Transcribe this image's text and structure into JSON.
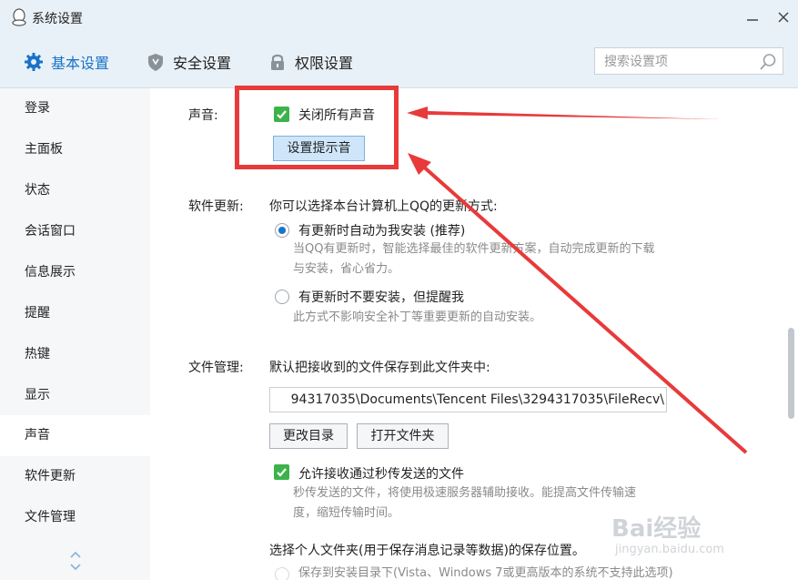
{
  "window": {
    "title": "系统设置",
    "minimize_icon": "minimize-icon",
    "close_icon": "close-icon"
  },
  "toolbar": {
    "tabs": [
      {
        "label": "基本设置",
        "icon": "gear-icon",
        "active": true
      },
      {
        "label": "安全设置",
        "icon": "shield-icon",
        "active": false
      },
      {
        "label": "权限设置",
        "icon": "lock-icon",
        "active": false
      }
    ],
    "search_placeholder": "搜索设置项"
  },
  "sidebar": {
    "items": [
      {
        "label": "登录"
      },
      {
        "label": "主面板"
      },
      {
        "label": "状态"
      },
      {
        "label": "会话窗口"
      },
      {
        "label": "信息展示"
      },
      {
        "label": "提醒"
      },
      {
        "label": "热键"
      },
      {
        "label": "显示"
      },
      {
        "label": "声音",
        "active": true
      },
      {
        "label": "软件更新"
      },
      {
        "label": "文件管理"
      }
    ]
  },
  "sound": {
    "label": "声音:",
    "mute_all": "关闭所有声音",
    "mute_all_checked": true,
    "set_tone_button": "设置提示音"
  },
  "update": {
    "label": "软件更新:",
    "intro": "你可以选择本台计算机上QQ的更新方式:",
    "option_auto": "有更新时自动为我安装 (推荐)",
    "option_auto_desc_1": "当QQ有更新时，智能选择最佳的软件更新方案，自动完成更新的下载",
    "option_auto_desc_2": "与安装，省心省力。",
    "option_notify": "有更新时不要安装，但提醒我",
    "option_notify_desc": "此方式不影响安全补丁等重要更新的自动安装。",
    "selected": "option_auto"
  },
  "files": {
    "label": "文件管理:",
    "intro": "默认把接收到的文件保存到此文件夹中:",
    "path": "94317035\\Documents\\Tencent Files\\3294317035\\FileRecv\\",
    "change_dir_button": "更改目录",
    "open_folder_button": "打开文件夹",
    "allow_fast": "允许接收通过秒传发送的文件",
    "allow_fast_checked": true,
    "allow_fast_desc_1": "秒传发送的文件，将使用极速服务器辅助接收。能提高文件传输速",
    "allow_fast_desc_2": "度，缩短传输时间。",
    "personal_folder": "选择个人文件夹(用于保存消息记录等数据)的保存位置。",
    "personal_folder_opt": "保存到安装目录下(Vista、Windows 7或更高版本的系统不支持此选项)"
  },
  "watermark": {
    "brand": "Bai经验",
    "url": "jingyan.baidu.com"
  },
  "colors": {
    "accent": "#1a73c9",
    "check": "#3cb34a",
    "annotation": "#e83a3a"
  }
}
